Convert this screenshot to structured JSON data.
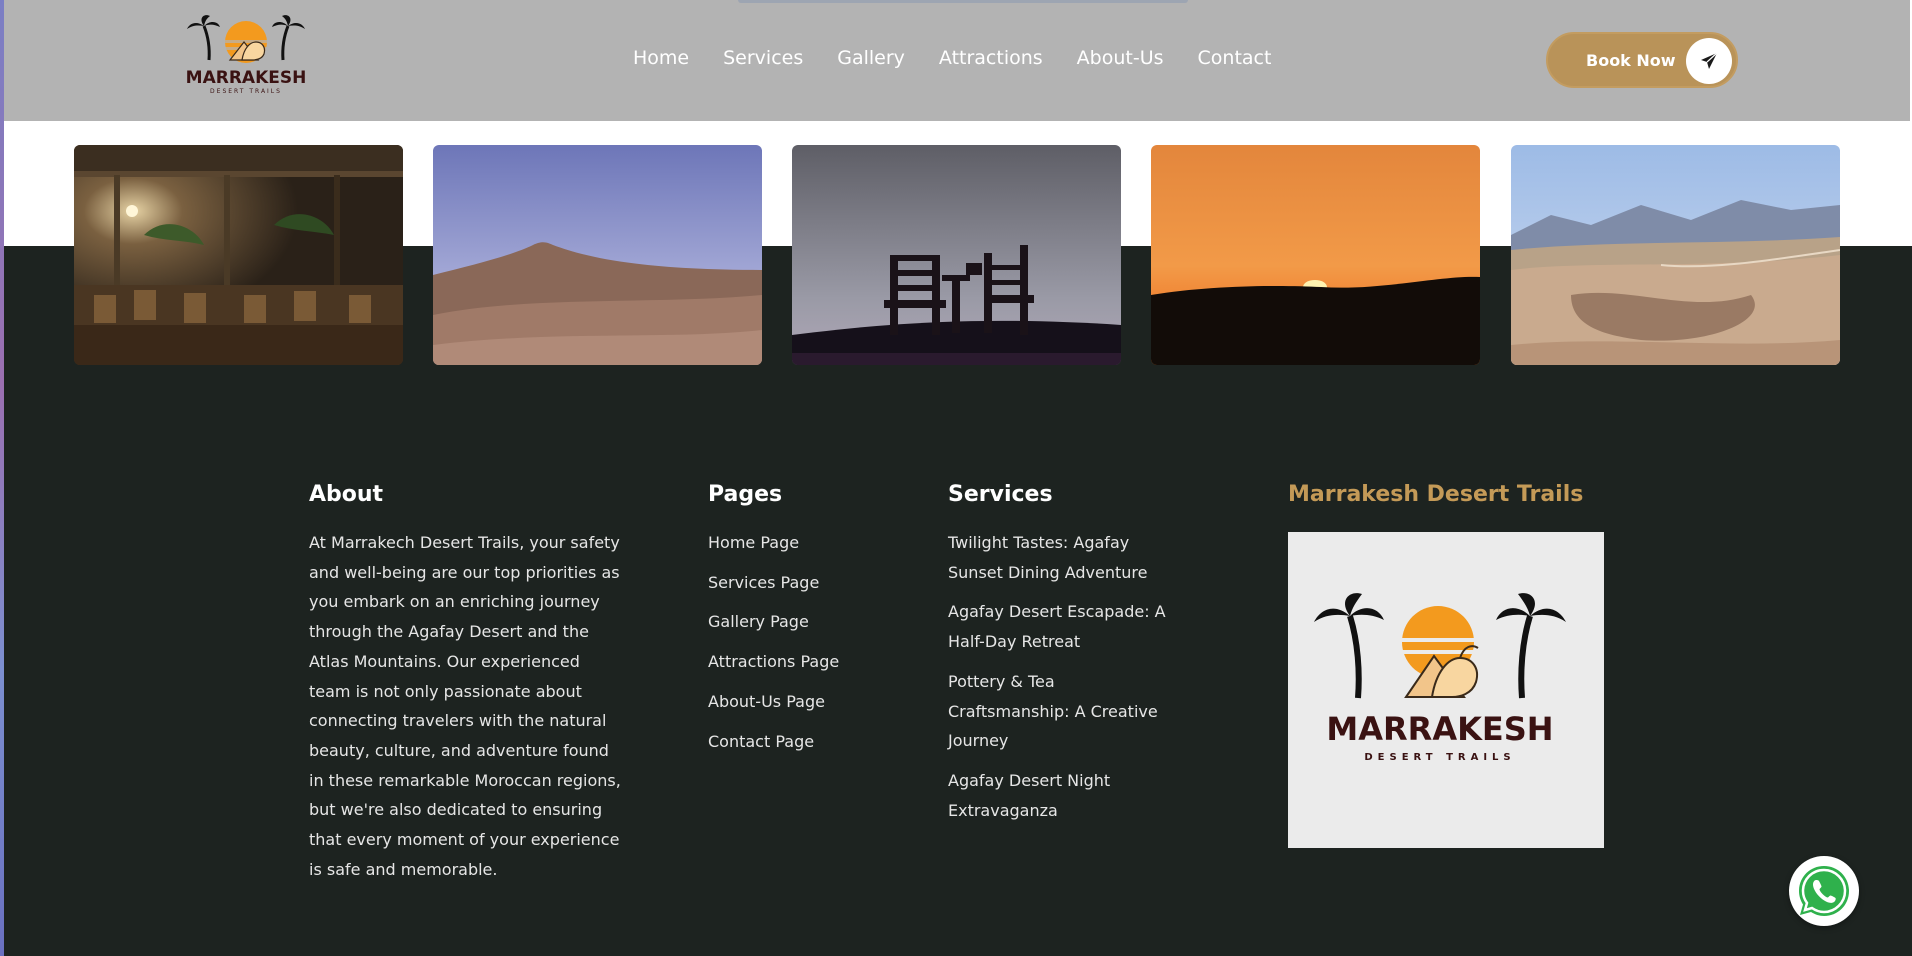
{
  "header": {
    "logo": {
      "name": "MARRAKESH",
      "tagline": "DESERT TRAILS"
    },
    "nav": [
      "Home",
      "Services",
      "Gallery",
      "Attractions",
      "About-Us",
      "Contact"
    ],
    "book_button": {
      "label": "Book Now",
      "icon": "paper-plane-icon"
    }
  },
  "gallery": {
    "photos": [
      {
        "subject": "dining-tent-night"
      },
      {
        "subject": "desert-hill-dusk"
      },
      {
        "subject": "chairs-silhouette"
      },
      {
        "subject": "sunset"
      },
      {
        "subject": "mountains-canyon"
      }
    ]
  },
  "footer": {
    "about": {
      "title": "About",
      "text": "At Marrakech Desert Trails, your safety and well-being are our top priorities as you embark on an enriching journey through the Agafay Desert and the Atlas Mountains. Our experienced team is not only passionate about connecting travelers with the natural beauty, culture, and adventure found in these remarkable Moroccan regions, but we're also dedicated to ensuring that every moment of your experience is safe and memorable."
    },
    "pages": {
      "title": "Pages",
      "links": [
        "Home Page",
        "Services Page",
        "Gallery Page",
        "Attractions Page",
        "About-Us Page",
        "Contact Page"
      ]
    },
    "services": {
      "title": "Services",
      "items": [
        "Twilight Tastes: Agafay Sunset Dining Adventure",
        "Agafay Desert Escapade: A Half-Day Retreat",
        "Pottery & Tea Craftsmanship: A Creative Journey",
        "Agafay Desert Night Extravaganza"
      ]
    },
    "brand": {
      "title": "Marrakesh Desert Trails",
      "logo_name": "MARRAKESH",
      "logo_tagline": "DESERT TRAILS"
    }
  },
  "whatsapp": {
    "icon": "whatsapp-icon"
  },
  "colors": {
    "header_bg": "#b3b3b3",
    "footer_bg": "#1d2320",
    "accent_gold": "#b99359",
    "brand_title": "#c49a57",
    "logo_text": "#3a1212",
    "sun_orange": "#f39a1e"
  }
}
